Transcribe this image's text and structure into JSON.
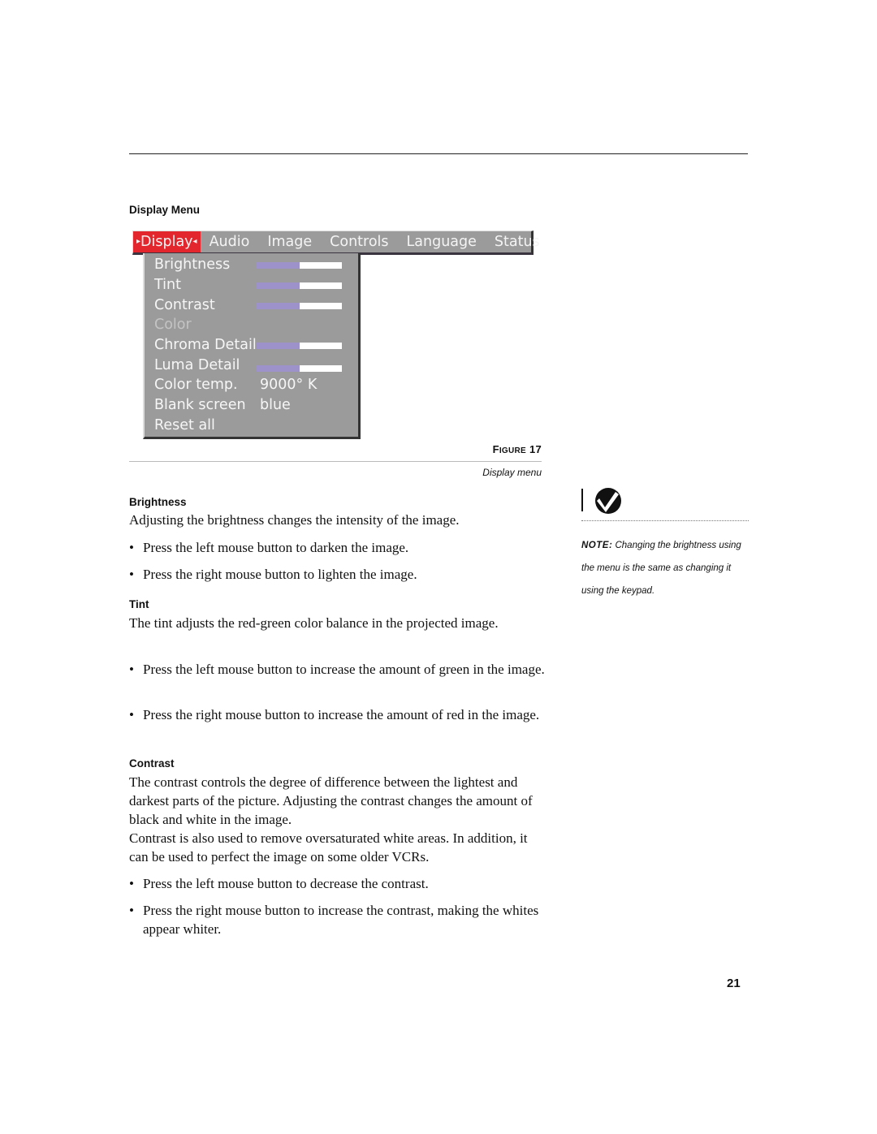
{
  "section_heading": "Display Menu",
  "menu": {
    "tabs": [
      {
        "label": "Display",
        "active": true
      },
      {
        "label": "Audio",
        "active": false
      },
      {
        "label": "Image",
        "active": false
      },
      {
        "label": "Controls",
        "active": false
      },
      {
        "label": "Language",
        "active": false
      },
      {
        "label": "Status",
        "active": false
      }
    ],
    "active_left_arrow": "▸",
    "active_right_arrow": "◂",
    "items": [
      {
        "label": "Brightness",
        "type": "slider",
        "level": 0.5
      },
      {
        "label": "Tint",
        "type": "slider",
        "level": 0.5
      },
      {
        "label": "Contrast",
        "type": "slider",
        "level": 0.5
      },
      {
        "label": "Color",
        "type": "disabled"
      },
      {
        "label": "Chroma Detail",
        "type": "slider",
        "level": 0.5
      },
      {
        "label": "Luma Detail",
        "type": "slider",
        "level": 0.5
      },
      {
        "label": "Color temp.",
        "type": "value",
        "value": "9000° K"
      },
      {
        "label": "Blank screen",
        "type": "value",
        "value": "blue"
      },
      {
        "label": "Reset all",
        "type": "action"
      }
    ],
    "colors": {
      "menu_bg": "#9b9b9c",
      "active_tab": "#e3262d",
      "slider_fill": "#9d92c9",
      "slider_track": "#ffffff"
    }
  },
  "figure": {
    "label_prefix": "F",
    "label_smallcaps": "IGURE",
    "number": "17",
    "caption": "Display menu"
  },
  "sections": {
    "brightness": {
      "heading": "Brightness",
      "intro": "Adjusting the brightness changes the intensity of the image.",
      "bullets": [
        "Press the left mouse button to darken the image.",
        "Press the right mouse button to lighten the image."
      ]
    },
    "tint": {
      "heading": "Tint",
      "intro": "The tint adjusts the red-green color balance in the projected image.",
      "bullets": [
        "Press the left mouse button to increase the amount of green in the image.",
        "Press the right mouse button to increase the amount of red in the image."
      ]
    },
    "contrast": {
      "heading": "Contrast",
      "intro": "The contrast controls the degree of difference between the lightest and darkest parts of the picture. Adjusting the contrast changes the amount of black and white in the image.",
      "intro2": "Contrast is also used to remove oversaturated white areas. In addition, it can be used to perfect the image on some older VCRs.",
      "bullets": [
        "Press the left mouse button to decrease the contrast.",
        "Press the right mouse button to increase the contrast, making the whites appear whiter."
      ]
    }
  },
  "note": {
    "label": "NOTE:",
    "text": " Changing the brightness using the menu is the same as changing it using the keypad."
  },
  "bullet_char": "•",
  "page_number": "21"
}
